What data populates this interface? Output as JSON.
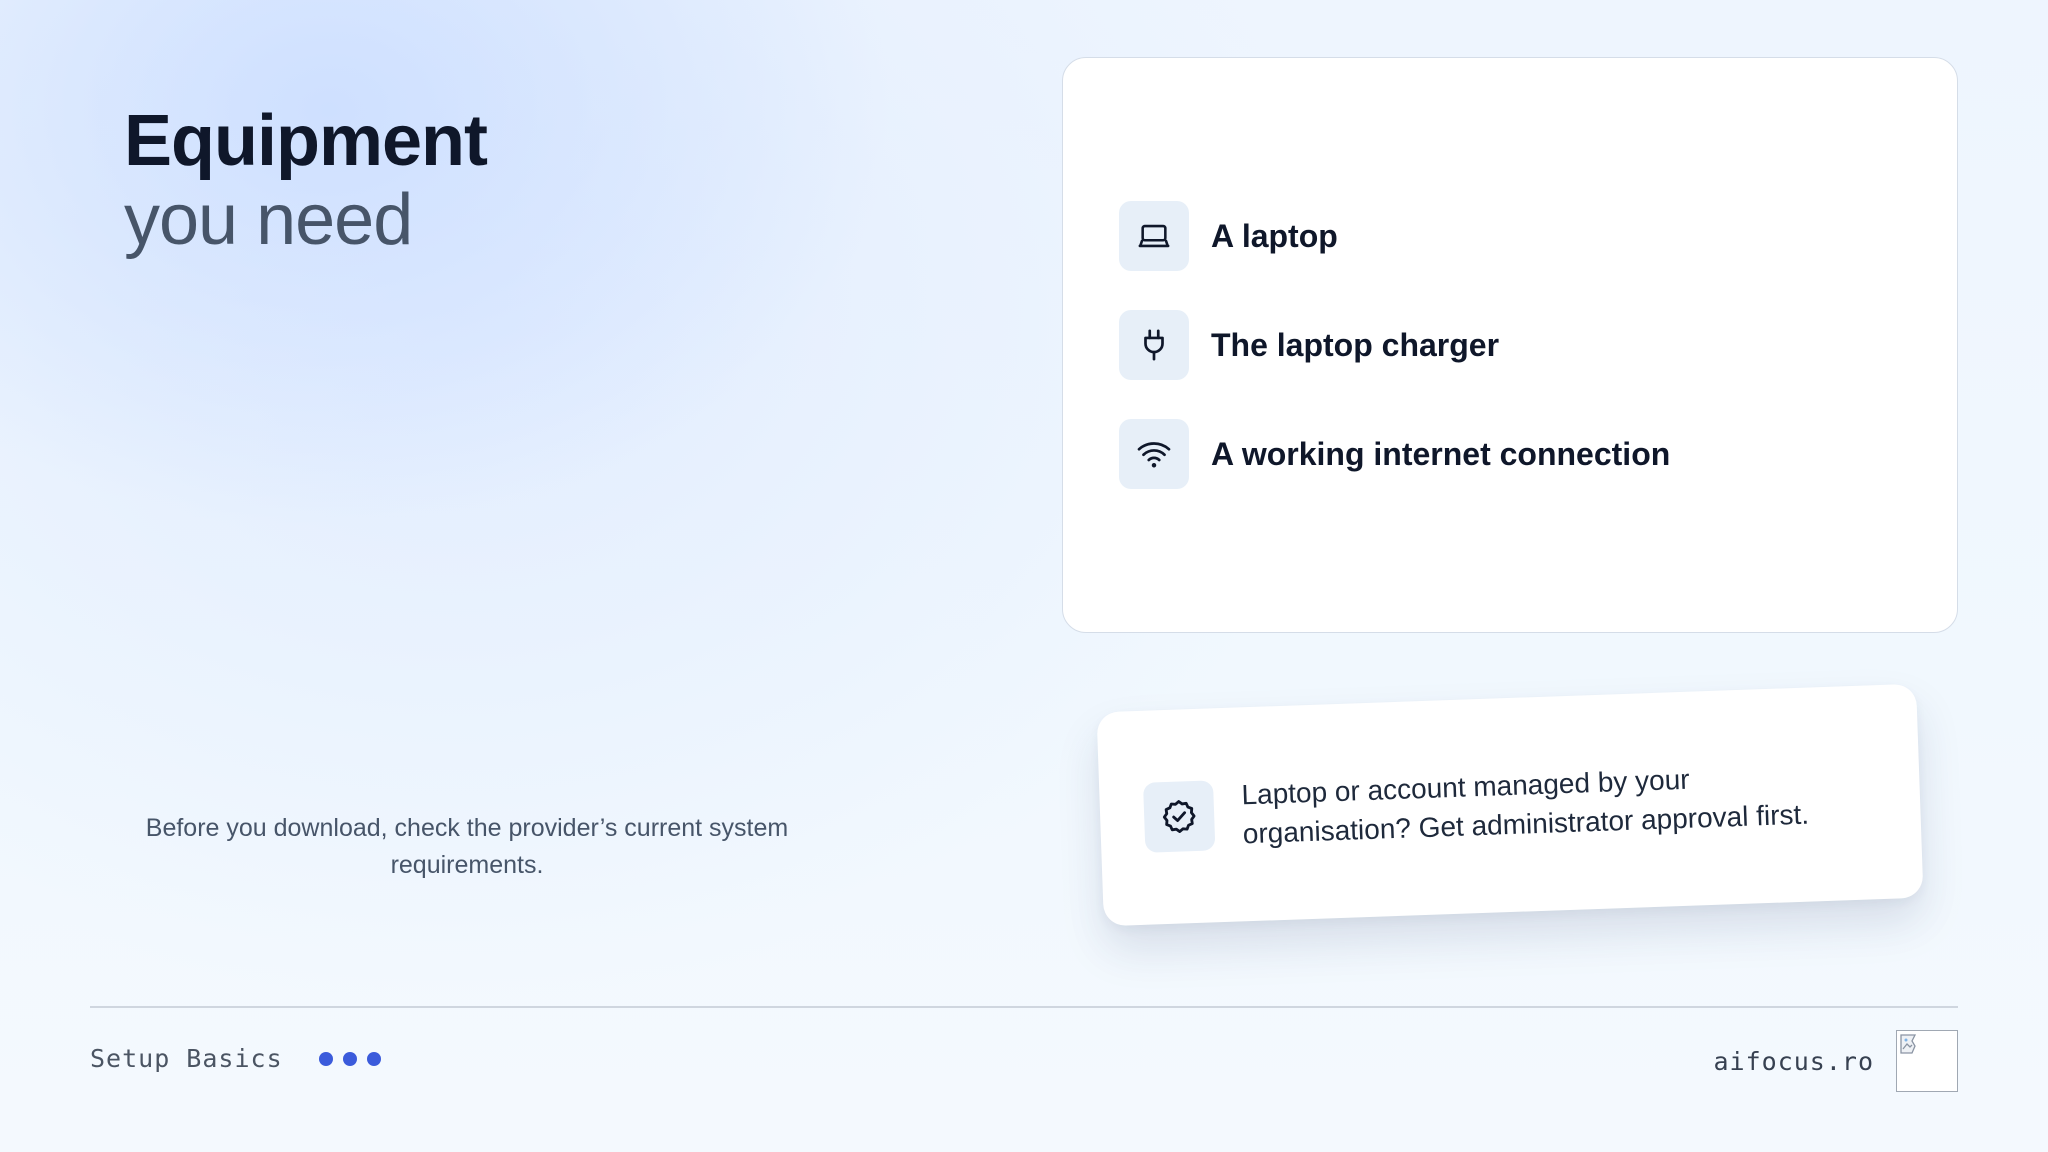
{
  "heading": {
    "line1": "Equipment",
    "line2": "you need"
  },
  "note": "Before you download, check the provider’s current system requirements.",
  "equipment_list": {
    "items": [
      {
        "label": "A laptop",
        "icon": "laptop-icon"
      },
      {
        "label": "The laptop charger",
        "icon": "plug-icon"
      },
      {
        "label": "A working internet connection",
        "icon": "wifi-icon"
      }
    ]
  },
  "callout": {
    "icon": "badge-check-icon",
    "text": "Laptop or account managed by your organisation? Get administrator approval first."
  },
  "footer": {
    "section_name": "Setup Basics",
    "site": "aifocus.ro",
    "logo_icon": "broken-image-icon",
    "accent_color": "#3b5bdb"
  }
}
